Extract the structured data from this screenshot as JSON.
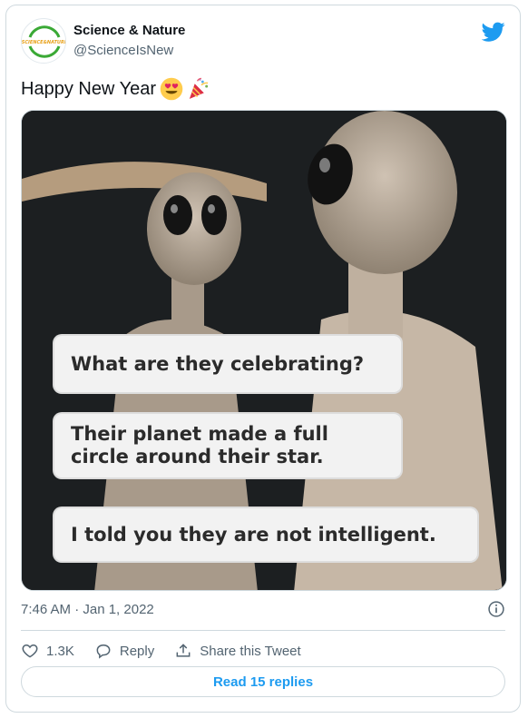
{
  "author": {
    "display_name": "Science & Nature",
    "handle": "@ScienceIsNew",
    "avatar_text": "SCIENCE & NATURE"
  },
  "tweet": {
    "text": "Happy New Year",
    "emojis": [
      "smiling-face-with-heart-eyes",
      "party-popper"
    ],
    "timestamp": "7:46 AM · Jan 1, 2022"
  },
  "media": {
    "bubbles": [
      "What are they celebrating?",
      "Their planet made a full circle around their star.",
      "I told you they are not intelligent."
    ],
    "bubble2_line1": "Their planet made a full",
    "bubble2_line2": "circle around their star."
  },
  "actions": {
    "likes": "1.3K",
    "reply_label": "Reply",
    "share_label": "Share this Tweet"
  },
  "read_replies_label": "Read 15 replies",
  "colors": {
    "accent": "#1d9bf0",
    "text": "#0f1419",
    "muted": "#536471",
    "border": "#cfd9de"
  }
}
